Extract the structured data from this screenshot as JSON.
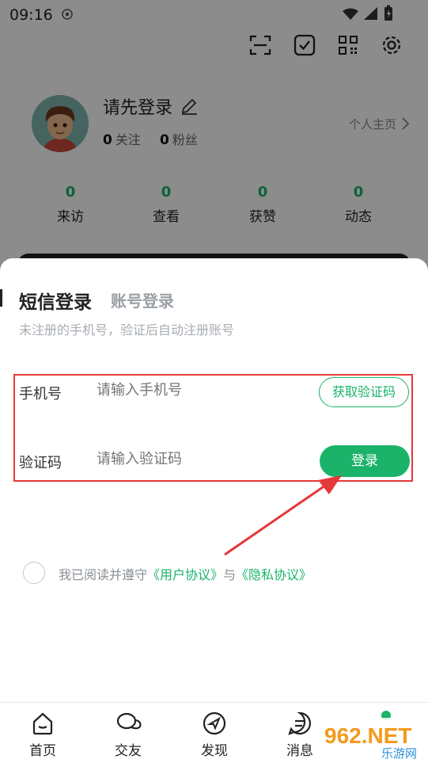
{
  "status_bar": {
    "time": "09:16"
  },
  "profile": {
    "name": "请先登录",
    "following_count": "0",
    "following_label": "关注",
    "fans_count": "0",
    "fans_label": "粉丝",
    "homepage_label": "个人主页"
  },
  "stats": [
    {
      "value": "0",
      "label": "来访"
    },
    {
      "value": "0",
      "label": "查看"
    },
    {
      "value": "0",
      "label": "获赞"
    },
    {
      "value": "0",
      "label": "动态"
    }
  ],
  "login_sheet": {
    "tab_sms": "短信登录",
    "tab_account": "账号登录",
    "hint": "未注册的手机号，验证后自动注册账号",
    "phone_label": "手机号",
    "phone_placeholder": "请输入手机号",
    "get_code_label": "获取验证码",
    "code_label": "验证码",
    "code_placeholder": "请输入验证码",
    "login_label": "登录",
    "agree_prefix": "我已阅读并遵守",
    "user_agreement": "《用户协议》",
    "agree_and": "与",
    "privacy_policy": "《隐私协议》"
  },
  "bottom_nav": [
    {
      "label": "首页",
      "icon": "home-icon"
    },
    {
      "label": "交友",
      "icon": "chat-bubbles-icon"
    },
    {
      "label": "发现",
      "icon": "compass-icon"
    },
    {
      "label": "消息",
      "icon": "message-icon"
    }
  ],
  "watermark": {
    "text_top": "962.NET",
    "text_bottom": "乐游网"
  },
  "colors": {
    "accent": "#1bb36a",
    "highlight_box": "#e53838",
    "arrow": "#e53838"
  }
}
